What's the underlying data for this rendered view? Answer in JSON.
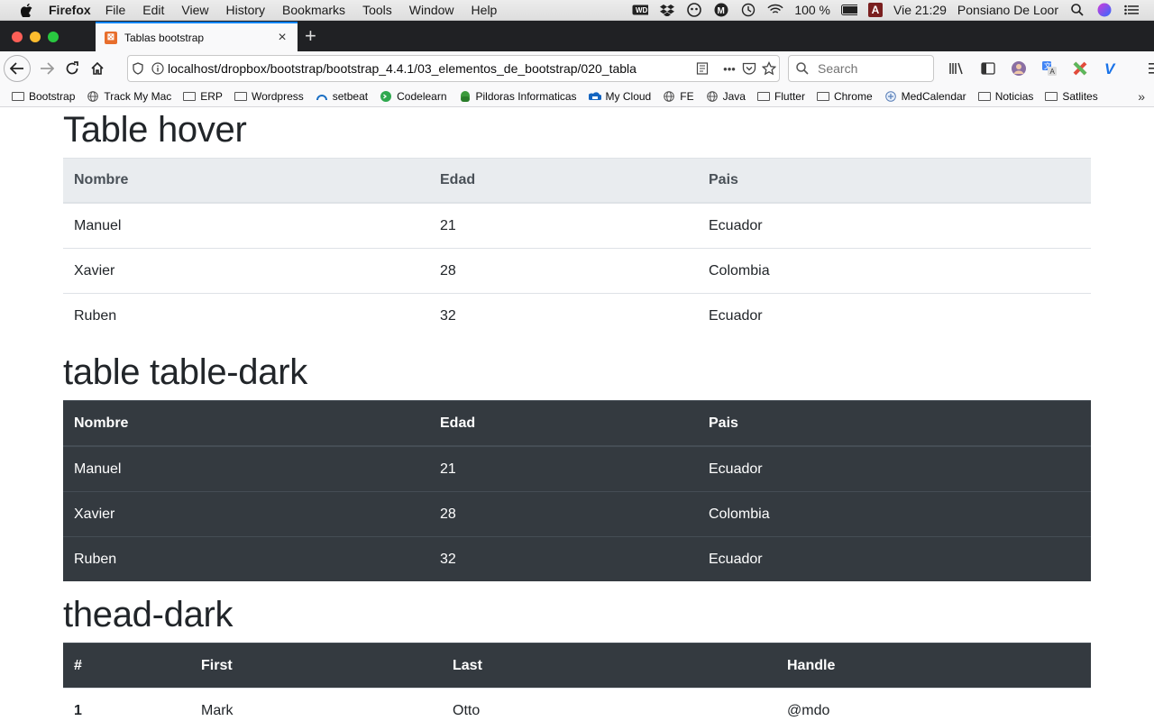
{
  "menubar": {
    "app_name": "Firefox",
    "menus": [
      "File",
      "Edit",
      "View",
      "History",
      "Bookmarks",
      "Tools",
      "Window",
      "Help"
    ],
    "battery": "100 %",
    "input_badge": "A",
    "clock": "Vie 21:29",
    "user": "Ponsiano De Loor"
  },
  "tab": {
    "title": "Tablas bootstrap"
  },
  "urlbar": {
    "url": "localhost/dropbox/bootstrap/bootstrap_4.4.1/03_elementos_de_bootstrap/020_tabla",
    "search_placeholder": "Search"
  },
  "bookmarks": [
    {
      "label": "Bootstrap",
      "icon": "folder-icon"
    },
    {
      "label": "Track My Mac",
      "icon": "globe-icon"
    },
    {
      "label": "ERP",
      "icon": "folder-icon"
    },
    {
      "label": "Wordpress",
      "icon": "folder-icon"
    },
    {
      "label": "setbeat",
      "icon": "setbeat-icon"
    },
    {
      "label": "Codelearn",
      "icon": "codelearn-icon"
    },
    {
      "label": "Pildoras Informaticas",
      "icon": "pildoras-icon"
    },
    {
      "label": "My Cloud",
      "icon": "cloud-icon"
    },
    {
      "label": "FE",
      "icon": "globe-icon"
    },
    {
      "label": "Java",
      "icon": "globe-icon"
    },
    {
      "label": "Flutter",
      "icon": "folder-icon"
    },
    {
      "label": "Chrome",
      "icon": "folder-icon"
    },
    {
      "label": "MedCalendar",
      "icon": "medcalendar-icon"
    },
    {
      "label": "Noticias",
      "icon": "folder-icon"
    },
    {
      "label": "Satlites",
      "icon": "folder-icon"
    }
  ],
  "sections": {
    "hover": {
      "heading": "Table hover",
      "headers": [
        "Nombre",
        "Edad",
        "Pais"
      ],
      "rows": [
        [
          "Manuel",
          "21",
          "Ecuador"
        ],
        [
          "Xavier",
          "28",
          "Colombia"
        ],
        [
          "Ruben",
          "32",
          "Ecuador"
        ]
      ]
    },
    "dark": {
      "heading": "table table-dark",
      "headers": [
        "Nombre",
        "Edad",
        "Pais"
      ],
      "rows": [
        [
          "Manuel",
          "21",
          "Ecuador"
        ],
        [
          "Xavier",
          "28",
          "Colombia"
        ],
        [
          "Ruben",
          "32",
          "Ecuador"
        ]
      ]
    },
    "thead_dark": {
      "heading": "thead-dark",
      "headers": [
        "#",
        "First",
        "Last",
        "Handle"
      ],
      "rows": [
        [
          "1",
          "Mark",
          "Otto",
          "@mdo"
        ]
      ]
    }
  }
}
